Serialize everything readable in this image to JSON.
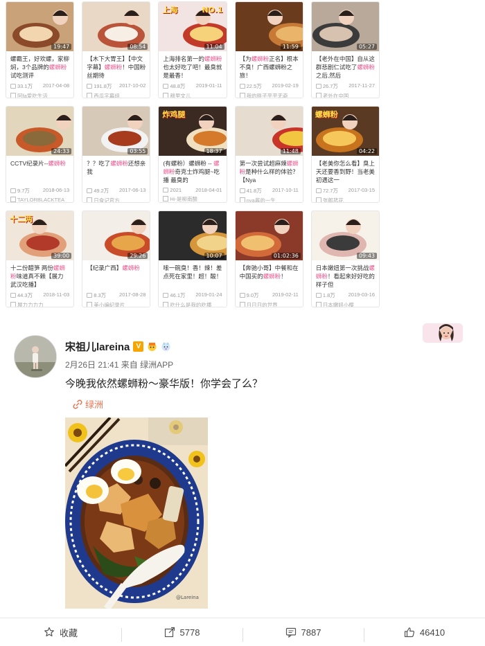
{
  "video_grid": [
    [
      {
        "duration": "19:47",
        "overlay": "",
        "title_pre": "螺霸王，好欢螺，家柳焖，3个品牌的",
        "kw": "螺蛳粉",
        "title_post": "试吃测评",
        "views": "33.1万",
        "date": "2017-04-08",
        "author": "阿fa爱吃生活"
      },
      {
        "duration": "08:54",
        "overlay": "",
        "title_pre": "【木下大胃王】【中文字幕】",
        "kw": "螺蛳粉",
        "title_post": "！中国粉丝期待",
        "views": "191.8万",
        "date": "2017-10-02",
        "author": "西瓜字幕组"
      },
      {
        "duration": "11:04",
        "overlay": "上海",
        "overlay2": "NO.1",
        "title_pre": "上海排名第一的",
        "kw": "螺蛳粉",
        "title_post": "也太好吃了吧！最臭就是最香！",
        "views": "48.8万",
        "date": "2019-01-11",
        "author": "穆里文儿"
      },
      {
        "duration": "11:59",
        "overlay": "",
        "title_pre": "【为",
        "kw": "螺蛳粉",
        "title_post": "正名】根本不臭！广西螺蛳粉之旅！",
        "views": "22.5万",
        "date": "2019-02-19",
        "author": "我的胖子平平无奇"
      },
      {
        "duration": "05:27",
        "overlay": "",
        "title_pre": "【老外在中国】自从这群悲剧仁试吃了",
        "kw": "螺蛳粉",
        "title_post": "之后,然后",
        "views": "26.7万",
        "date": "2017-11-27",
        "author": "老外在中国"
      }
    ],
    [
      {
        "duration": "24:33",
        "overlay": "",
        "title_pre": "CCTV纪录片--",
        "kw": "螺蛳粉",
        "title_post": "",
        "views": "9.7万",
        "date": "2018-06-13",
        "author": "TAYLORBLACKTEA"
      },
      {
        "duration": "03:55",
        "overlay": "",
        "title_pre": "？？吃了",
        "kw": "螺蛳粉",
        "title_post": "还想亲我",
        "views": "49.2万",
        "date": "2017-06-13",
        "author": "日食记官方"
      },
      {
        "duration": "18:37",
        "overlay": "炸鸡腿",
        "title_pre": "(有螺粉）螺蛳粉 -- ",
        "kw": "螺蛳粉",
        "title_post": "奇克士炸鸡腿~吃播 最臭的",
        "views": "2021",
        "date": "2018-04-01",
        "author": "Hi-是柳南酸"
      },
      {
        "duration": "11:48",
        "overlay": "",
        "title_pre": "第一次尝试超麻辣",
        "kw": "螺蛳粉",
        "title_post": "是种什么样的体验？【Nya",
        "views": "41.8万",
        "date": "2017-10-11",
        "author": "nya酱的一生"
      },
      {
        "duration": "04:22",
        "overlay": "螺蛳粉",
        "title_pre": "【老美你怎么看】臭上天还要香到野！当老美初遇这一",
        "kw": "",
        "title_post": "",
        "views": "72.7万",
        "date": "2017-03-15",
        "author": "张郎悲花"
      }
    ],
    [
      {
        "duration": "39:00",
        "overlay": "十二两",
        "title_pre": "十二份醋笋 两份",
        "kw": "螺蛳粉",
        "title_post": "味道真不赖【展力 武汉吃播】",
        "views": "44.3万",
        "date": "2018-11-03",
        "author": "展力力力力"
      },
      {
        "duration": "29:26",
        "overlay": "",
        "title_pre": "【纪录广西】",
        "kw": "螺蛳粉",
        "title_post": "",
        "views": "8.3万",
        "date": "2017-08-28",
        "author": "美小编纪录片"
      },
      {
        "duration": "10:07",
        "overlay": "",
        "title_pre": "嗦一碗臭！香！辣！",
        "kw": "",
        "title_post": "差点死在家里！超！酸！",
        "views": "46.1万",
        "date": "2019-01-24",
        "author": "吃什么是我的吃播"
      },
      {
        "duration": "01:02:36",
        "overlay": "",
        "title_pre": "【奔驰小哥】中餐和在中国买的",
        "kw": "螺蛳粉",
        "title_post": "！",
        "views": "9.0万",
        "date": "2019-02-11",
        "author": "日日日的世界"
      },
      {
        "duration": "09:43",
        "overlay": "",
        "title_pre": "日本嫩妞第一次挑战",
        "kw": "螺蛳粉",
        "title_post": "！看起来好好吃的样子但",
        "views": "1.8万",
        "date": "2019-03-16",
        "author": "日本嫩妞小樱"
      }
    ]
  ],
  "post": {
    "author": "宋祖儿lareina",
    "verified": "V",
    "time": "2月26日 21:41",
    "source_prefix": "来自",
    "source": "绿洲APP",
    "text": "今晚我依然螺蛳粉～豪华版！你学会了么？",
    "tag": "绿洲"
  },
  "actions": {
    "favorite_label": "收藏",
    "repost_count": "5778",
    "comment_count": "7887",
    "like_count": "46410"
  },
  "colors": {
    "keyword_pink": "#e8548c",
    "tag_orange": "#eb7350",
    "verified_gold": "#f7a500"
  }
}
